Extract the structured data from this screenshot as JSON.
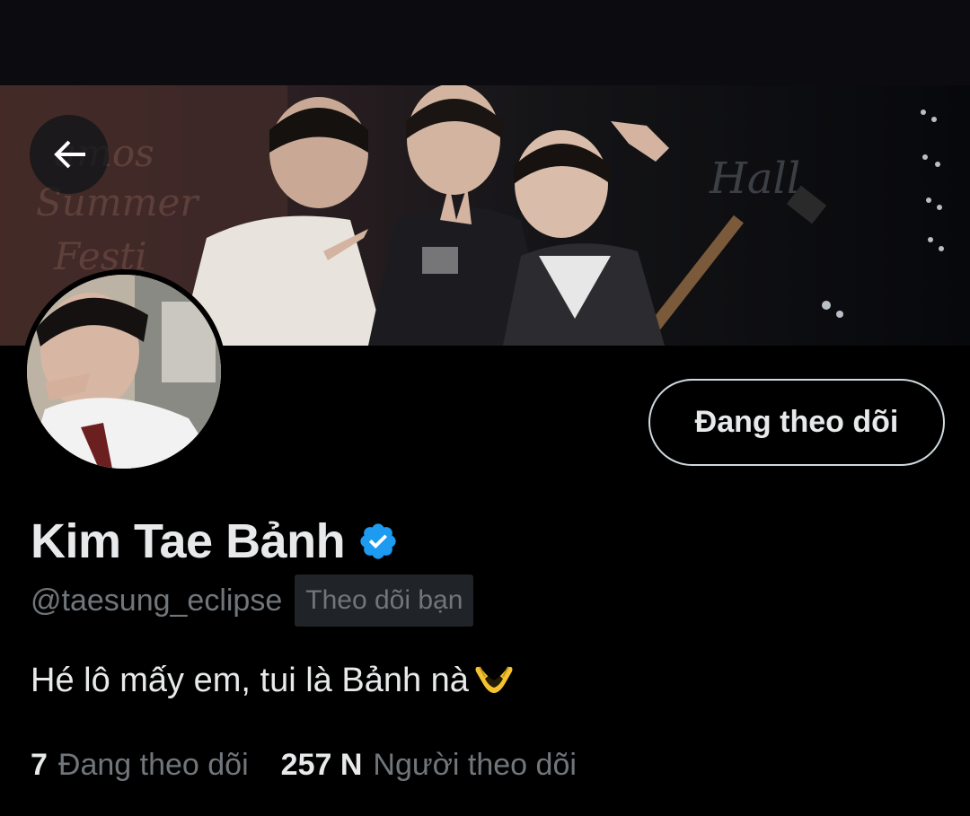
{
  "header": {
    "back_icon": "arrow-left-icon"
  },
  "banner": {
    "description_icon": "banner-photo"
  },
  "profile": {
    "display_name": "Kim Tae Bảnh",
    "verified_icon": "verified-badge-icon",
    "handle": "@taesung_eclipse",
    "follows_you_label": "Theo dõi bạn",
    "bio": "Hé lô mấy em, tui là Bảnh nà",
    "bio_emoji_icon": "heart-hands-icon",
    "follow_button_label": "Đang theo dõi"
  },
  "stats": {
    "following_count": "7",
    "following_label": "Đang theo dõi",
    "followers_count": "257 N",
    "followers_label": "Người theo dõi"
  },
  "colors": {
    "background": "#000000",
    "primary_text": "#e7e9ea",
    "secondary_text": "#71767b",
    "verified_blue": "#1d9bf0",
    "badge_bg": "#202327",
    "button_border": "#cfd9de"
  }
}
